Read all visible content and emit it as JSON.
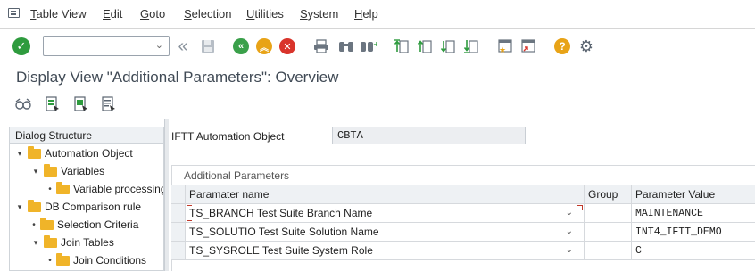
{
  "menubar": {
    "items": [
      {
        "label": "Table View",
        "ul": "T",
        "rest": "able View"
      },
      {
        "label": "Edit",
        "ul": "E",
        "rest": "dit"
      },
      {
        "label": "Goto",
        "ul": "G",
        "rest": "oto"
      },
      {
        "label": "Selection",
        "ul": "S",
        "rest": "election"
      },
      {
        "label": "Utilities",
        "ul": "U",
        "rest": "tilities"
      },
      {
        "label": "System",
        "ul": "S",
        "rest": "ystem"
      },
      {
        "label": "Help",
        "ul": "H",
        "rest": "elp"
      }
    ]
  },
  "toolbar": {
    "command_field_value": "",
    "icons": [
      "enter-icon",
      "back-icon",
      "save-icon",
      "back-green-icon",
      "exit-icon",
      "cancel-icon",
      "print-icon",
      "find-icon",
      "find-next-icon",
      "first-page-icon",
      "previous-page-icon",
      "next-page-icon",
      "last-page-icon",
      "create-session-icon",
      "shortcut-icon",
      "help-icon",
      "settings-icon"
    ],
    "colors": {
      "enter": "#2e9b3e",
      "exit_green": "#3aa04a",
      "exit_yellow": "#e8a317",
      "cancel": "#d9342b",
      "help": "#e8a317"
    }
  },
  "title": "Display View \"Additional Parameters\": Overview",
  "apptoolbar": {
    "icons": [
      "display-changes-icon",
      "select-all-icon",
      "select-block-icon",
      "deselect-all-icon"
    ]
  },
  "tree": {
    "header": "Dialog Structure",
    "items": [
      {
        "label": "Automation Object",
        "level": 0,
        "toggle": "▾"
      },
      {
        "label": "Variables",
        "level": 1,
        "toggle": "▾"
      },
      {
        "label": "Variable processing",
        "level": 2,
        "toggle": "•"
      },
      {
        "label": "DB Comparison rule",
        "level": 0,
        "toggle": "▾"
      },
      {
        "label": "Selection Criteria",
        "level": 1,
        "toggle": "•"
      },
      {
        "label": "Join Tables",
        "level": 1,
        "toggle": "▾"
      },
      {
        "label": "Join Conditions",
        "level": 2,
        "toggle": "•"
      }
    ]
  },
  "object": {
    "label": "IFTT Automation Object",
    "value": "CBTA"
  },
  "params": {
    "section_title": "Additional Parameters",
    "columns": [
      "Paramater name",
      "Group",
      "Parameter Value"
    ],
    "rows": [
      {
        "name": "TS_BRANCH Test Suite Branch Name",
        "group": "",
        "value": "MAINTENANCE"
      },
      {
        "name": "TS_SOLUTIO Test Suite Solution Name",
        "group": "",
        "value": "INT4_IFTT_DEMO"
      },
      {
        "name": "TS_SYSROLE Test Suite System Role",
        "group": "",
        "value": "C"
      }
    ]
  }
}
